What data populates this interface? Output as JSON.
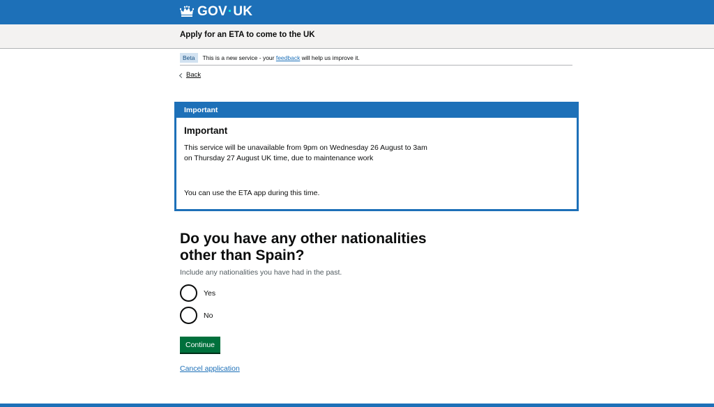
{
  "header": {
    "logo_text_left": "GOV",
    "logo_dot": "·",
    "logo_text_right": "UK"
  },
  "service": {
    "name": "Apply for an ETA to come to the UK"
  },
  "phase_banner": {
    "tag": "Beta",
    "text_before": "This is a new service - your ",
    "link": "feedback",
    "text_after": " will help us improve it."
  },
  "back_link": "Back",
  "notification": {
    "title": "Important",
    "heading": "Important",
    "line1": "This service will be unavailable from 9pm on Wednesday 26 August to 3am",
    "line2": "on Thursday 27 August UK time,  due to maintenance work",
    "line3": "You can use the ETA app during this time."
  },
  "question": {
    "title_line1": "Do you have any other nationalities",
    "title_line2": "other than Spain?",
    "hint": "Include any nationalities you have had in the past.",
    "options": [
      {
        "label": "Yes",
        "selected": false
      },
      {
        "label": "No",
        "selected": false
      }
    ]
  },
  "actions": {
    "continue": "Continue",
    "cancel": "Cancel application"
  },
  "colors": {
    "brand_blue": "#1d70b8",
    "button_green": "#00703c",
    "service_bar": "#f3f2f1"
  }
}
